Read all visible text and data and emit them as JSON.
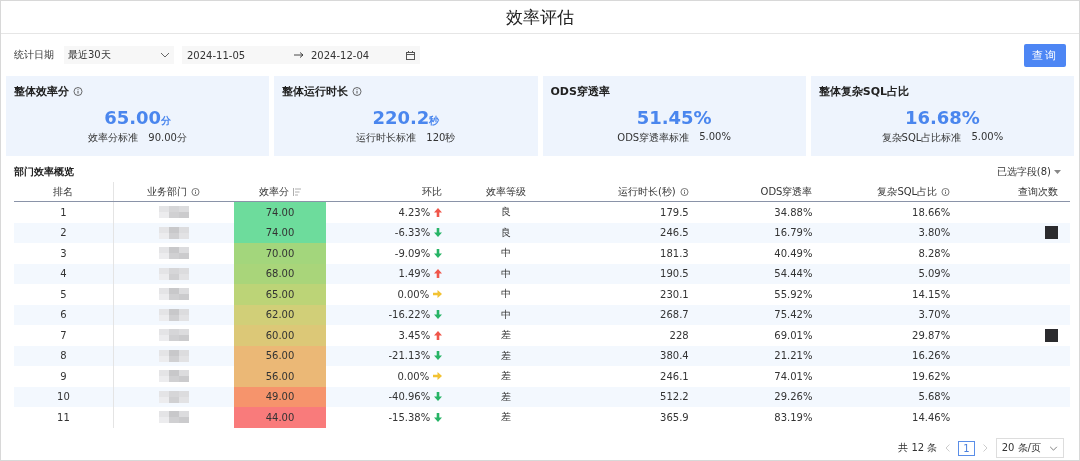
{
  "title": "效率评估",
  "filters": {
    "date_label": "统计日期",
    "range_preset": "最近30天",
    "start_date": "2024-11-05",
    "end_date": "2024-12-04",
    "query_button": "查询"
  },
  "cards": [
    {
      "title": "整体效率分",
      "info": true,
      "value": "65.00",
      "unit": "分",
      "standard_label": "效率分标准",
      "standard_value": "90.00分"
    },
    {
      "title": "整体运行时长",
      "info": true,
      "value": "220.2",
      "unit": "秒",
      "standard_label": "运行时长标准",
      "standard_value": "120秒"
    },
    {
      "title": "ODS穿透率",
      "info": false,
      "value": "51.45%",
      "standard_label": "ODS穿透率标准",
      "standard_value": "5.00%"
    },
    {
      "title": "整体复杂SQL占比",
      "info": false,
      "value": "16.68%",
      "standard_label": "复杂SQL占比标准",
      "standard_value": "5.00%"
    }
  ],
  "table": {
    "title": "部门效率概览",
    "field_picker": "已选字段(8)",
    "columns": [
      {
        "label": "排名",
        "info": false
      },
      {
        "label": "业务部门",
        "info": true
      },
      {
        "label": "效率分",
        "info": false,
        "sortable": true
      },
      {
        "label": "环比",
        "info": false
      },
      {
        "label": "效率等级",
        "info": false
      },
      {
        "label": "运行时长(秒)",
        "info": true
      },
      {
        "label": "ODS穿透率",
        "info": false
      },
      {
        "label": "复杂SQL占比",
        "info": true
      },
      {
        "label": "查询次数",
        "info": false
      }
    ],
    "rows": [
      {
        "rank": "1",
        "score": "74.00",
        "color": "#6ddc9c",
        "change": "4.23%",
        "kind": "up",
        "grade": "良",
        "runtime": "179.5",
        "ods": "34.88%",
        "sql": "18.66%",
        "query_redacted": false
      },
      {
        "rank": "2",
        "score": "74.00",
        "color": "#6ddc9c",
        "change": "-6.33%",
        "kind": "down",
        "grade": "良",
        "runtime": "246.5",
        "ods": "16.79%",
        "sql": "3.80%",
        "query_redacted": true
      },
      {
        "rank": "3",
        "score": "70.00",
        "color": "#a3d67c",
        "change": "-9.09%",
        "kind": "down",
        "grade": "中",
        "runtime": "181.3",
        "ods": "40.49%",
        "sql": "8.28%",
        "query_redacted": false
      },
      {
        "rank": "4",
        "score": "68.00",
        "color": "#a9d57a",
        "change": "1.49%",
        "kind": "up",
        "grade": "中",
        "runtime": "190.5",
        "ods": "54.44%",
        "sql": "5.09%",
        "query_redacted": false
      },
      {
        "rank": "5",
        "score": "65.00",
        "color": "#bcd477",
        "change": "0.00%",
        "kind": "flat",
        "grade": "中",
        "runtime": "230.1",
        "ods": "55.92%",
        "sql": "14.15%",
        "query_redacted": false
      },
      {
        "rank": "6",
        "score": "62.00",
        "color": "#d1cf78",
        "change": "-16.22%",
        "kind": "down",
        "grade": "中",
        "runtime": "268.7",
        "ods": "75.42%",
        "sql": "3.70%",
        "query_redacted": false
      },
      {
        "rank": "7",
        "score": "60.00",
        "color": "#dcc877",
        "change": "3.45%",
        "kind": "up",
        "grade": "差",
        "runtime": "228",
        "ods": "69.01%",
        "sql": "29.87%",
        "query_redacted": true
      },
      {
        "rank": "8",
        "score": "56.00",
        "color": "#ebb876",
        "change": "-21.13%",
        "kind": "down",
        "grade": "差",
        "runtime": "380.4",
        "ods": "21.21%",
        "sql": "16.26%",
        "query_redacted": false
      },
      {
        "rank": "9",
        "score": "56.00",
        "color": "#ebb876",
        "change": "0.00%",
        "kind": "flat",
        "grade": "差",
        "runtime": "246.1",
        "ods": "74.01%",
        "sql": "19.62%",
        "query_redacted": false
      },
      {
        "rank": "10",
        "score": "49.00",
        "color": "#f6946c",
        "change": "-40.96%",
        "kind": "down",
        "grade": "差",
        "runtime": "512.2",
        "ods": "29.26%",
        "sql": "5.68%",
        "query_redacted": false
      },
      {
        "rank": "11",
        "score": "44.00",
        "color": "#f97b7b",
        "change": "-15.38%",
        "kind": "down",
        "grade": "差",
        "runtime": "365.9",
        "ods": "83.19%",
        "sql": "14.46%",
        "query_redacted": false
      }
    ]
  },
  "pagination": {
    "total": "共 12 条",
    "page": "1",
    "page_size": "20 条/页"
  }
}
